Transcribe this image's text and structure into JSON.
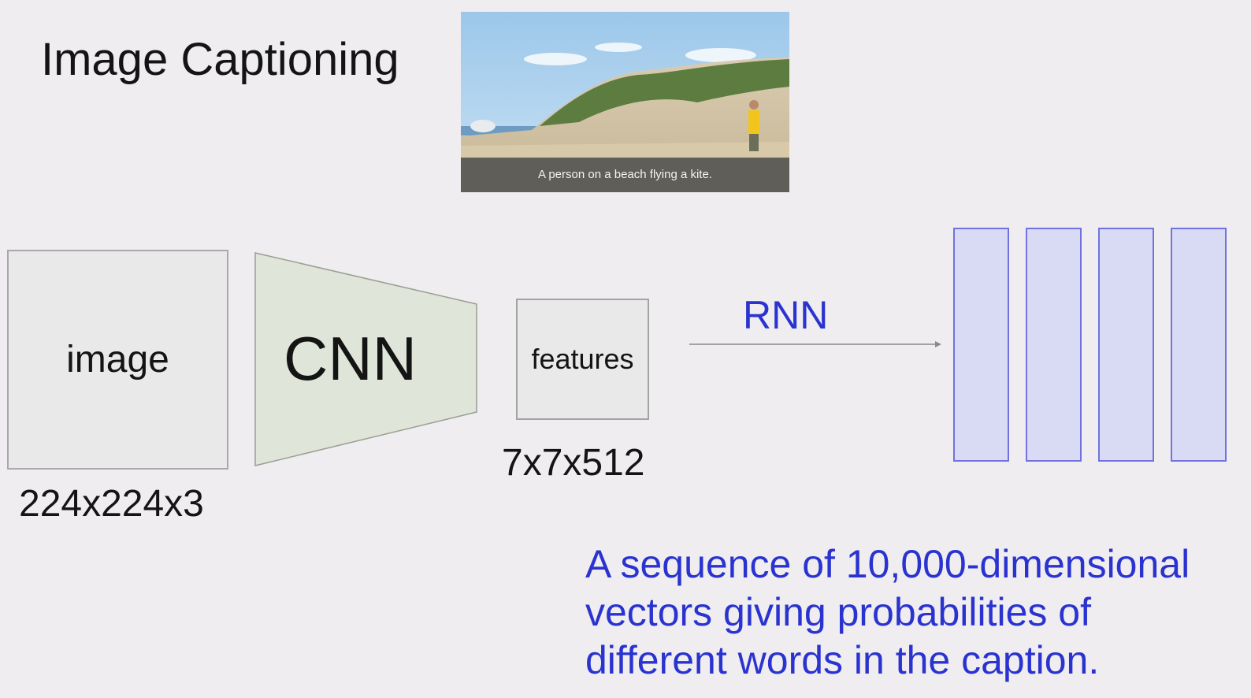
{
  "slide": {
    "title": "Image Captioning"
  },
  "photo": {
    "caption": "A person on a beach flying a kite."
  },
  "diagram": {
    "image_label": "image",
    "image_dims": "224x224x3",
    "cnn_label": "CNN",
    "features_label": "features",
    "features_dims": "7x7x512",
    "rnn_label": "RNN",
    "output_vector_count": 4,
    "description": "A sequence of 10,000-dimensional vectors giving probabilities of different words in the caption."
  },
  "colors": {
    "background": "#efedf0",
    "cnn_fill": "#dfe5d8",
    "accent_blue": "#2a33d0",
    "vector_fill": "#d9daf3",
    "vector_border": "#6f72e0"
  }
}
